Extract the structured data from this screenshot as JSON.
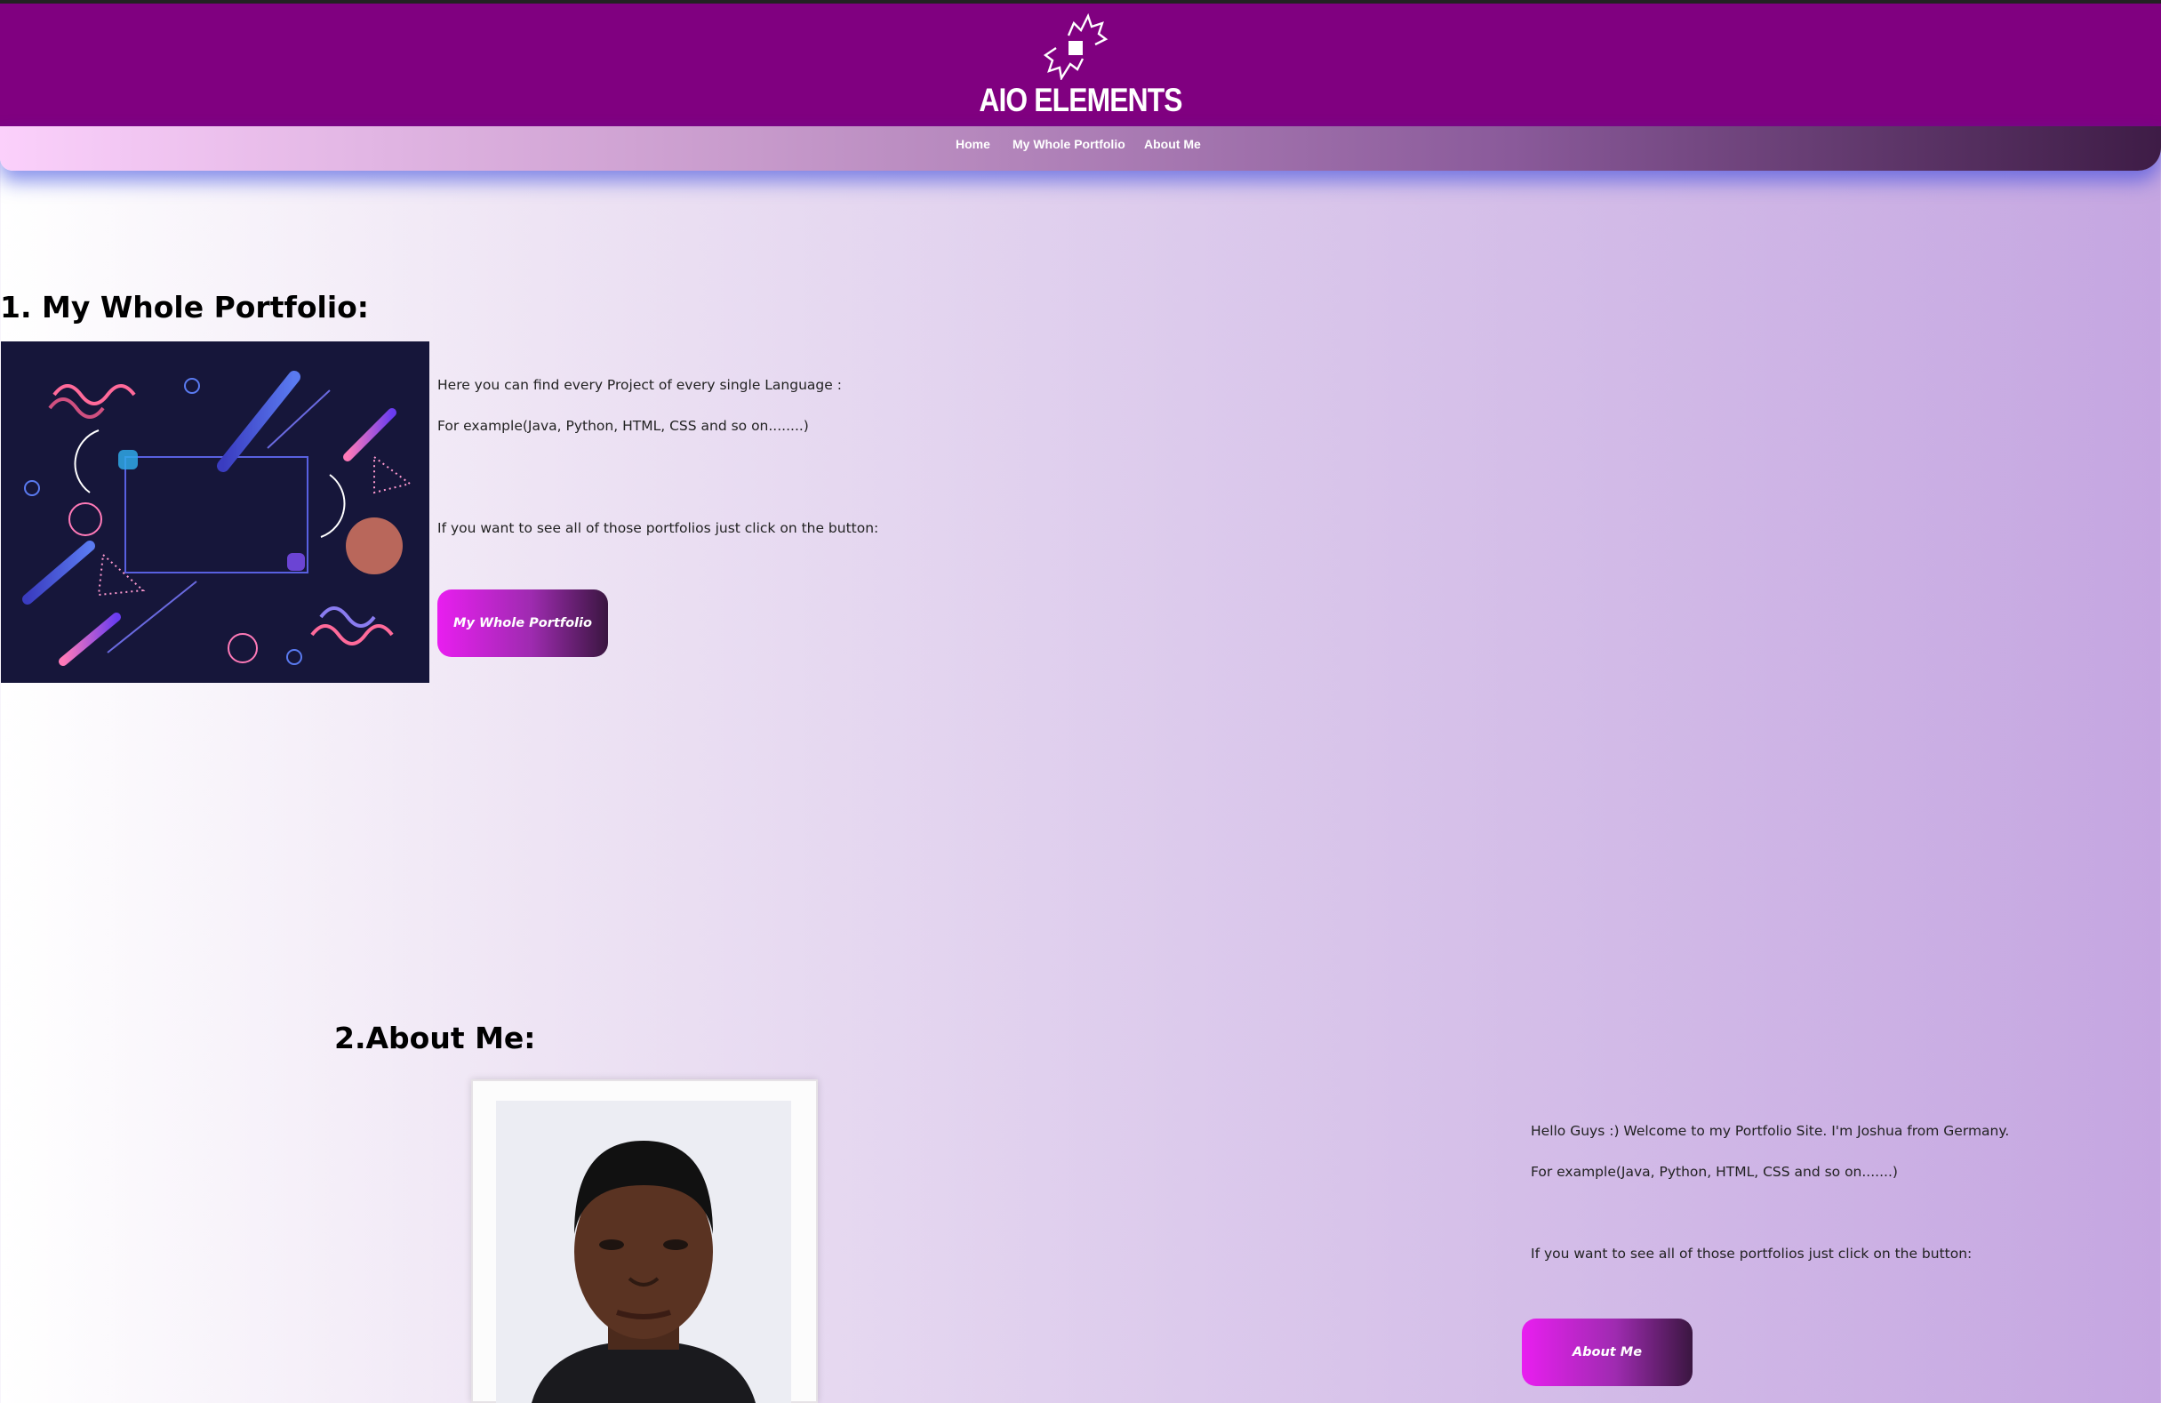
{
  "header": {
    "brand": "AIO ELEMENTS",
    "logo_icon": "aio-elements-logo-icon"
  },
  "nav": {
    "items": [
      {
        "label": "Home"
      },
      {
        "label": "My Whole Portfolio"
      },
      {
        "label": "About Me"
      }
    ]
  },
  "portfolio": {
    "title": "1. My Whole Portfolio:",
    "image": "abstract-geometric-banner",
    "line1": "Here you can find every Project of every single Language :",
    "line2": "For example(Java, Python, HTML, CSS and so on........)",
    "line3": "If you want to see all of those portfolios just click on the button:",
    "button_label": "My Whole Portfolio"
  },
  "about": {
    "title": "2.About Me:",
    "photo": "portrait-photo",
    "line1": "Hello Guys :) Welcome to my Portfolio Site. I'm Joshua from Germany.",
    "line2": "For example(Java, Python, HTML, CSS and so on.......)",
    "line3": "If you want to see all of those portfolios just click on the button:",
    "button_label": "About Me"
  },
  "colors": {
    "header_bg": "#800080",
    "button_start": "#e91ef0",
    "button_end": "#3a1640"
  }
}
